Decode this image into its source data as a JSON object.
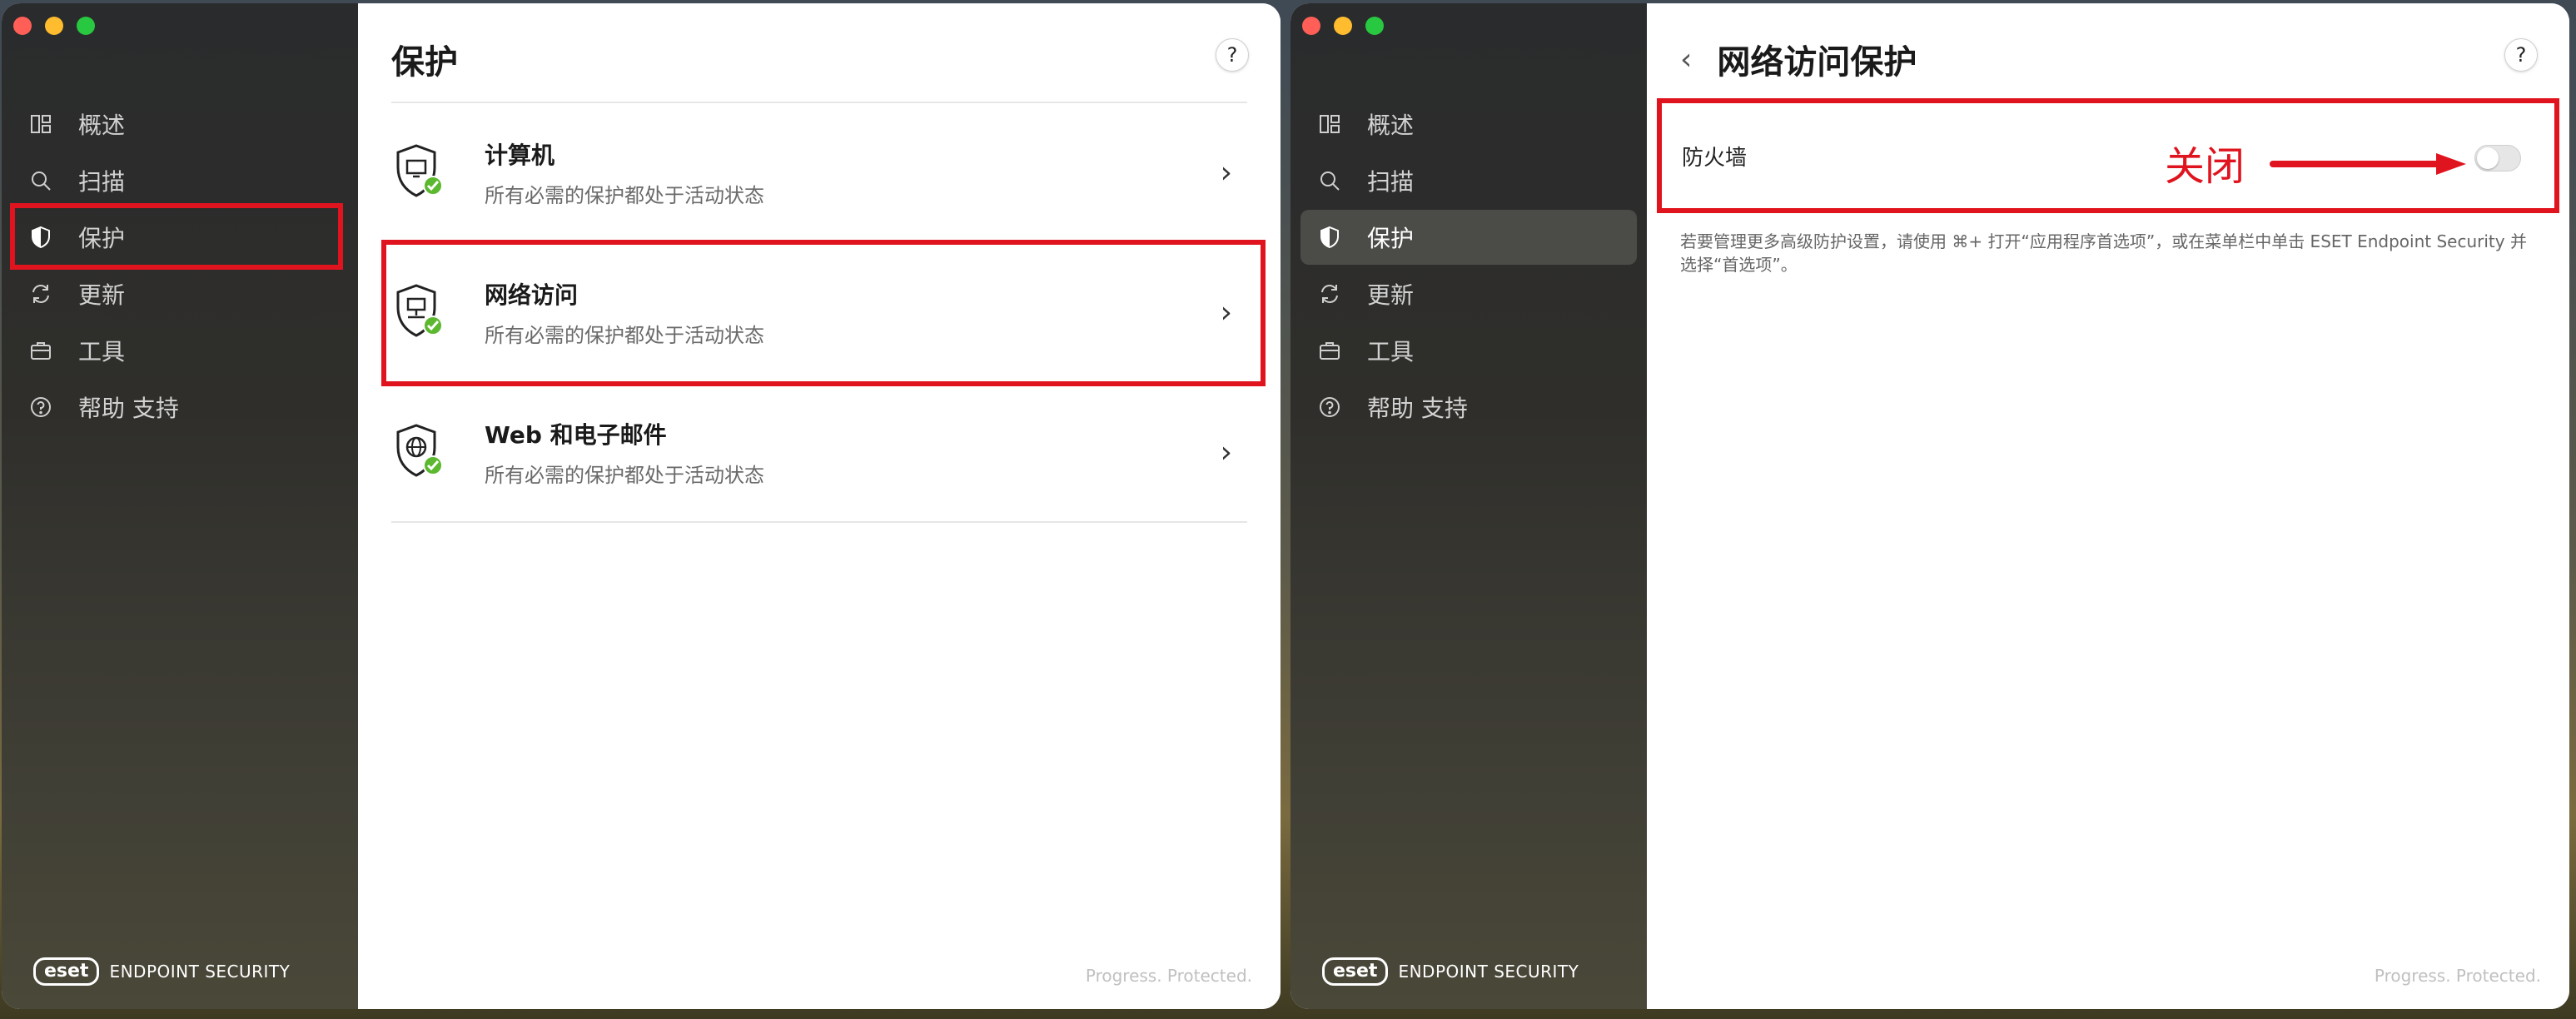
{
  "left_window": {
    "sidebar": {
      "items": [
        {
          "label": "概述",
          "icon": "dashboard-icon"
        },
        {
          "label": "扫描",
          "icon": "search-icon"
        },
        {
          "label": "保护",
          "icon": "shield-icon"
        },
        {
          "label": "更新",
          "icon": "refresh-icon"
        },
        {
          "label": "工具",
          "icon": "briefcase-icon"
        },
        {
          "label": "帮助 支持",
          "icon": "help-icon"
        }
      ],
      "active": "保护",
      "brand_logo": "eset",
      "brand_text": "ENDPOINT SECURITY"
    },
    "main": {
      "title": "保护",
      "help": "?",
      "rows": [
        {
          "title": "计算机",
          "subtitle": "所有必需的保护都处于活动状态",
          "icon": "computer-shield-icon"
        },
        {
          "title": "网络访问",
          "subtitle": "所有必需的保护都处于活动状态",
          "icon": "network-shield-icon"
        },
        {
          "title": "Web 和电子邮件",
          "subtitle": "所有必需的保护都处于活动状态",
          "icon": "globe-shield-icon"
        }
      ],
      "footer": "Progress. Protected."
    }
  },
  "right_window": {
    "sidebar": {
      "items": [
        {
          "label": "概述",
          "icon": "dashboard-icon"
        },
        {
          "label": "扫描",
          "icon": "search-icon"
        },
        {
          "label": "保护",
          "icon": "shield-icon"
        },
        {
          "label": "更新",
          "icon": "refresh-icon"
        },
        {
          "label": "工具",
          "icon": "briefcase-icon"
        },
        {
          "label": "帮助 支持",
          "icon": "help-icon"
        }
      ],
      "active": "保护",
      "brand_logo": "eset",
      "brand_text": "ENDPOINT SECURITY"
    },
    "main": {
      "back": "‹",
      "title": "网络访问保护",
      "help": "?",
      "firewall_label": "防火墙",
      "firewall_enabled": false,
      "annotation": "关闭",
      "note": "若要管理更多高级防护设置，请使用 ⌘+ 打开“应用程序首选项”，或在菜单栏中单击 ESET Endpoint Security 并选择“首选项”。",
      "footer": "Progress. Protected."
    }
  },
  "colors": {
    "highlight": "#e0141e",
    "ok_green": "#5cb82e",
    "sidebar_bg": "#2c2c2c"
  }
}
